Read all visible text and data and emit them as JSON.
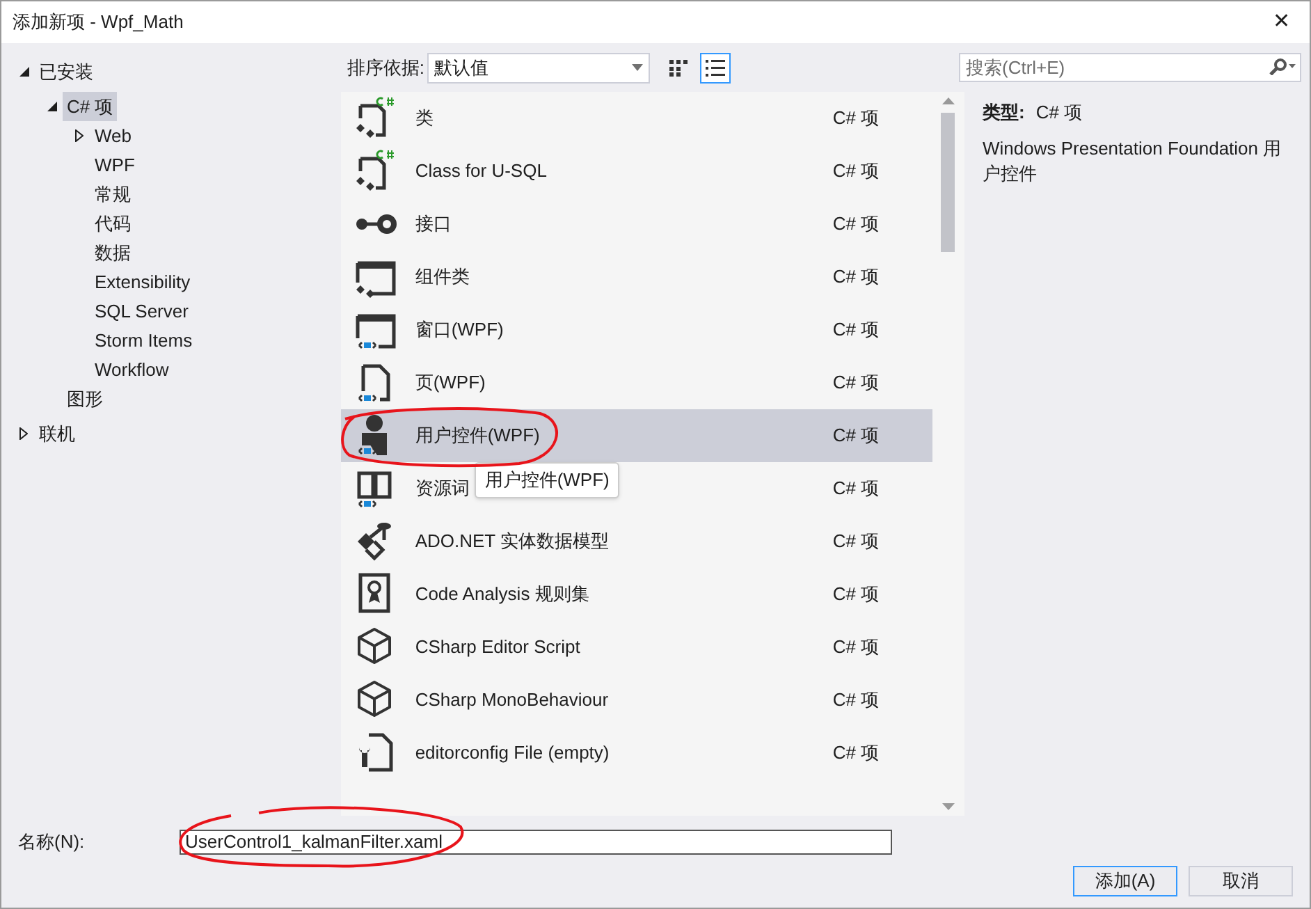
{
  "window": {
    "title": "添加新项 - Wpf_Math",
    "close": "✕"
  },
  "tree": [
    {
      "label": "已安装",
      "expanded": true,
      "selected": false,
      "children": [
        {
          "label": "C# 项",
          "expanded": true,
          "selected": true,
          "children": [
            {
              "label": "Web",
              "expanded": false,
              "selected": false
            },
            {
              "label": "WPF",
              "selected": false
            },
            {
              "label": "常规",
              "selected": false
            },
            {
              "label": "代码",
              "selected": false
            },
            {
              "label": "数据",
              "selected": false
            },
            {
              "label": "Extensibility",
              "selected": false
            },
            {
              "label": "SQL Server",
              "selected": false
            },
            {
              "label": "Storm Items",
              "selected": false
            },
            {
              "label": "Workflow",
              "selected": false
            }
          ]
        },
        {
          "label": "图形",
          "selected": false
        }
      ]
    },
    {
      "label": "联机",
      "expanded": false,
      "selected": false
    }
  ],
  "toolbar": {
    "sort_label": "排序依据:",
    "sort_value": "默认值",
    "views": [
      {
        "kind": "grid",
        "selected": false
      },
      {
        "kind": "list",
        "selected": true
      }
    ]
  },
  "search": {
    "placeholder": "搜索(Ctrl+E)"
  },
  "templates": [
    {
      "kind": "class",
      "name": "类",
      "type": "C# 项",
      "selected": false
    },
    {
      "kind": "class",
      "name": "Class for U-SQL",
      "type": "C# 项",
      "selected": false
    },
    {
      "kind": "interface",
      "name": "接口",
      "type": "C# 项",
      "selected": false
    },
    {
      "kind": "component",
      "name": "组件类",
      "type": "C# 项",
      "selected": false
    },
    {
      "kind": "window",
      "name": "窗口(WPF)",
      "type": "C# 项",
      "selected": false
    },
    {
      "kind": "page",
      "name": "页(WPF)",
      "type": "C# 项",
      "selected": false
    },
    {
      "kind": "usercontrol",
      "name": "用户控件(WPF)",
      "type": "C# 项",
      "selected": true
    },
    {
      "kind": "dictionary",
      "name": "资源词",
      "type": "C# 项",
      "selected": false
    },
    {
      "kind": "model",
      "name": "ADO.NET 实体数据模型",
      "type": "C# 项",
      "selected": false
    },
    {
      "kind": "ruleset",
      "name": "Code Analysis 规则集",
      "type": "C# 项",
      "selected": false
    },
    {
      "kind": "cube",
      "name": "CSharp Editor Script",
      "type": "C# 项",
      "selected": false
    },
    {
      "kind": "cube",
      "name": "CSharp MonoBehaviour",
      "type": "C# 项",
      "selected": false
    },
    {
      "kind": "config",
      "name": "editorconfig File (empty)",
      "type": "C# 项",
      "selected": false
    }
  ],
  "tooltip": "用户控件(WPF)",
  "details": {
    "type_label": "类型:",
    "type_value": "C# 项",
    "description": "Windows Presentation Foundation 用户控件"
  },
  "name_field": {
    "label": "名称(N):",
    "value": "UserControl1_kalmanFilter.xaml"
  },
  "buttons": [
    {
      "label": "添加(A)",
      "kind": "default"
    },
    {
      "label": "取消",
      "kind": "normal"
    }
  ]
}
